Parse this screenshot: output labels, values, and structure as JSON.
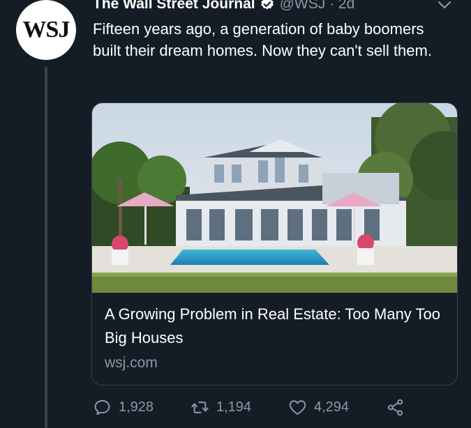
{
  "author": {
    "display_name": "The Wall Street Journal",
    "handle": "@WSJ · 2d",
    "avatar_text": "WSJ"
  },
  "tweet": {
    "text": "Fifteen years ago, a generation of baby boomers built their dream homes. Now they can't sell them."
  },
  "card": {
    "title": "A Growing Problem in Real Estate: Too Many Too Big Houses",
    "domain": "wsj.com",
    "image_icon": "house-with-pool-photo"
  },
  "actions": {
    "replies": "1,928",
    "retweets": "1,194",
    "likes": "4,294"
  },
  "colors": {
    "background": "#141d26",
    "secondary_text": "#8899a6",
    "border": "#38444d",
    "verified": "#ffffff"
  }
}
